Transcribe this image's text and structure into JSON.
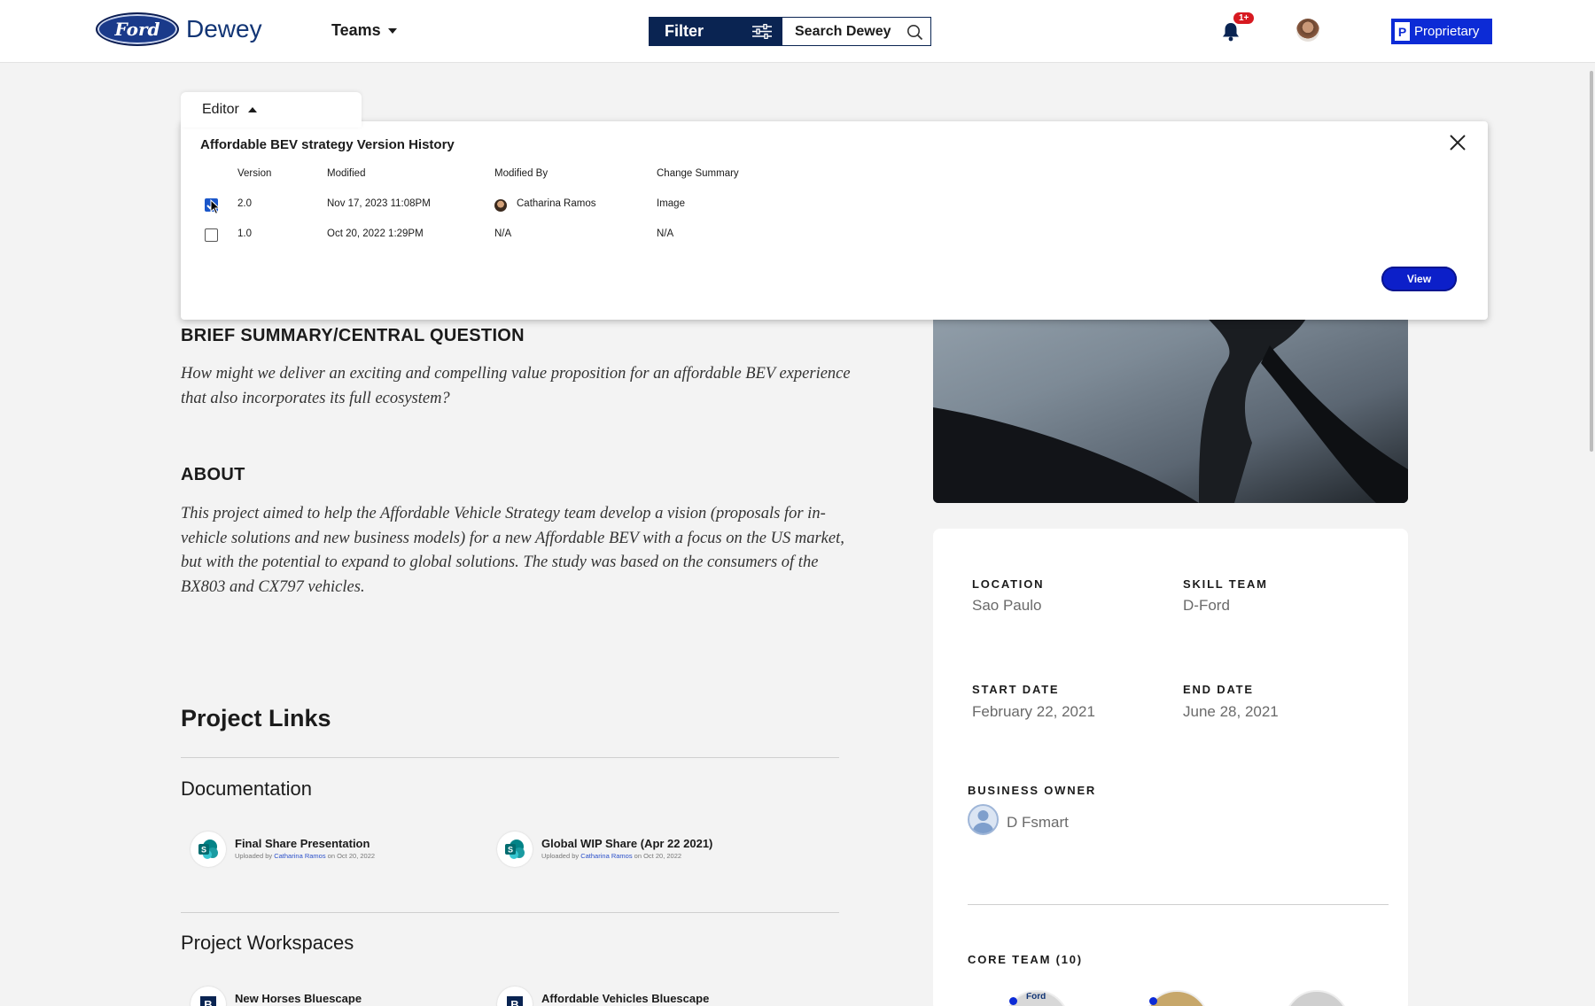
{
  "header": {
    "logo_text": "Ford",
    "app_name": "Dewey",
    "teams_label": "Teams",
    "filter_label": "Filter",
    "search_label": "Search Dewey",
    "notification_count": "1+",
    "proprietary_icon_letter": "P",
    "proprietary_label": "Proprietary",
    "accent_color": "#0c2bd6",
    "navy_color": "#0a2452"
  },
  "editor": {
    "tab_label": "Editor",
    "panel_title": "Affordable BEV strategy Version History",
    "columns": [
      "Version",
      "Modified",
      "Modified By",
      "Change Summary"
    ],
    "rows": [
      {
        "checked": true,
        "version": "2.0",
        "modified": "Nov 17, 2023 11:08PM",
        "modified_by": "Catharina Ramos",
        "summary": "Image"
      },
      {
        "checked": false,
        "version": "1.0",
        "modified": "Oct 20, 2022 1:29PM",
        "modified_by": "N/A",
        "summary": "N/A"
      }
    ],
    "view_button": "View"
  },
  "content": {
    "brief_heading": "BRIEF SUMMARY/CENTRAL QUESTION",
    "brief_text": "How might we deliver an exciting and compelling value proposition for an affordable BEV experience that also incorporates its full ecosystem?",
    "about_heading": "ABOUT",
    "about_text": "This project aimed to help the Affordable Vehicle Strategy team develop a vision (proposals for in-vehicle solutions and new business models) for a new Affordable BEV with a focus on the US market, but with the potential to expand to global solutions. The study was based on the consumers of the BX803 and CX797 vehicles.",
    "project_links_heading": "Project Links",
    "documentation_heading": "Documentation",
    "documents": [
      {
        "title": "Final Share Presentation",
        "uploaded_prefix": "Uploaded by",
        "uploader": "Catharina Ramos",
        "uploaded_suffix": "on Oct 20, 2022",
        "icon": "sharepoint-icon"
      },
      {
        "title": "Global WIP Share (Apr 22 2021)",
        "uploaded_prefix": "Uploaded by",
        "uploader": "Catharina Ramos",
        "uploaded_suffix": "on Oct 20, 2022",
        "icon": "sharepoint-icon"
      }
    ],
    "workspaces_heading": "Project Workspaces",
    "workspaces": [
      {
        "title": "New Horses Bluescape",
        "icon": "bluescape-icon"
      },
      {
        "title": "Affordable Vehicles Bluescape",
        "icon": "bluescape-icon"
      }
    ]
  },
  "sidebar": {
    "location_label": "LOCATION",
    "location_value": "Sao Paulo",
    "skill_team_label": "SKILL TEAM",
    "skill_team_value": "D-Ford",
    "start_date_label": "START DATE",
    "start_date_value": "February 22, 2021",
    "end_date_label": "END DATE",
    "end_date_value": "June 28, 2021",
    "business_owner_label": "BUSINESS OWNER",
    "business_owner_value": "D Fsmart",
    "core_team_label": "CORE TEAM (10)",
    "core_team_first_badge": "Ford"
  }
}
